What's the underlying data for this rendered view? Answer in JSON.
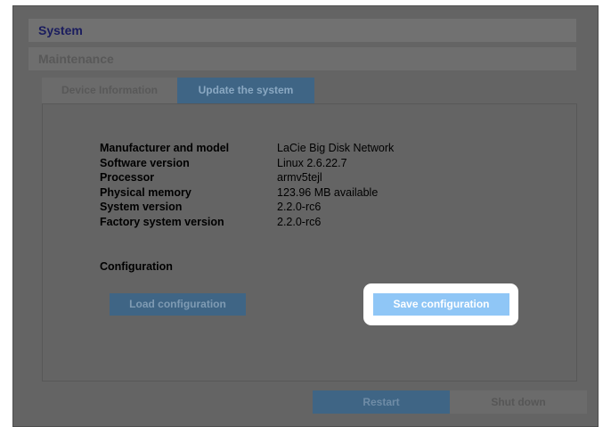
{
  "header": {
    "system_label": "System",
    "maintenance_label": "Maintenance"
  },
  "tabs": [
    {
      "label": "Device Information",
      "active": false
    },
    {
      "label": "Update the system",
      "active": true
    }
  ],
  "device_info": [
    {
      "label": "Manufacturer and model",
      "value": "LaCie Big Disk Network"
    },
    {
      "label": "Software version",
      "value": "Linux 2.6.22.7"
    },
    {
      "label": "Processor",
      "value": "armv5tejl"
    },
    {
      "label": "Physical memory",
      "value": "123.96 MB available"
    },
    {
      "label": "System version",
      "value": "2.2.0-rc6"
    },
    {
      "label": "Factory system version",
      "value": "2.2.0-rc6"
    }
  ],
  "configuration": {
    "title": "Configuration",
    "load_label": "Load configuration",
    "save_label": "Save configuration"
  },
  "footer": {
    "restart_label": "Restart",
    "shutdown_label": "Shut down"
  },
  "colors": {
    "overlay": "#646464",
    "accent": "#3f6585",
    "highlight_button": "#8fc6f6"
  }
}
